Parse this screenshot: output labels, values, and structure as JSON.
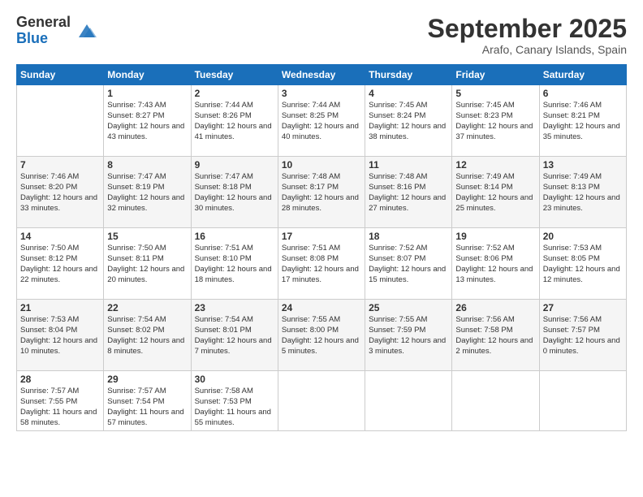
{
  "logo": {
    "general": "General",
    "blue": "Blue"
  },
  "header": {
    "title": "September 2025",
    "subtitle": "Arafo, Canary Islands, Spain"
  },
  "weekdays": [
    "Sunday",
    "Monday",
    "Tuesday",
    "Wednesday",
    "Thursday",
    "Friday",
    "Saturday"
  ],
  "weeks": [
    [
      {
        "num": "",
        "sunrise": "",
        "sunset": "",
        "daylight": ""
      },
      {
        "num": "1",
        "sunrise": "Sunrise: 7:43 AM",
        "sunset": "Sunset: 8:27 PM",
        "daylight": "Daylight: 12 hours and 43 minutes."
      },
      {
        "num": "2",
        "sunrise": "Sunrise: 7:44 AM",
        "sunset": "Sunset: 8:26 PM",
        "daylight": "Daylight: 12 hours and 41 minutes."
      },
      {
        "num": "3",
        "sunrise": "Sunrise: 7:44 AM",
        "sunset": "Sunset: 8:25 PM",
        "daylight": "Daylight: 12 hours and 40 minutes."
      },
      {
        "num": "4",
        "sunrise": "Sunrise: 7:45 AM",
        "sunset": "Sunset: 8:24 PM",
        "daylight": "Daylight: 12 hours and 38 minutes."
      },
      {
        "num": "5",
        "sunrise": "Sunrise: 7:45 AM",
        "sunset": "Sunset: 8:23 PM",
        "daylight": "Daylight: 12 hours and 37 minutes."
      },
      {
        "num": "6",
        "sunrise": "Sunrise: 7:46 AM",
        "sunset": "Sunset: 8:21 PM",
        "daylight": "Daylight: 12 hours and 35 minutes."
      }
    ],
    [
      {
        "num": "7",
        "sunrise": "Sunrise: 7:46 AM",
        "sunset": "Sunset: 8:20 PM",
        "daylight": "Daylight: 12 hours and 33 minutes."
      },
      {
        "num": "8",
        "sunrise": "Sunrise: 7:47 AM",
        "sunset": "Sunset: 8:19 PM",
        "daylight": "Daylight: 12 hours and 32 minutes."
      },
      {
        "num": "9",
        "sunrise": "Sunrise: 7:47 AM",
        "sunset": "Sunset: 8:18 PM",
        "daylight": "Daylight: 12 hours and 30 minutes."
      },
      {
        "num": "10",
        "sunrise": "Sunrise: 7:48 AM",
        "sunset": "Sunset: 8:17 PM",
        "daylight": "Daylight: 12 hours and 28 minutes."
      },
      {
        "num": "11",
        "sunrise": "Sunrise: 7:48 AM",
        "sunset": "Sunset: 8:16 PM",
        "daylight": "Daylight: 12 hours and 27 minutes."
      },
      {
        "num": "12",
        "sunrise": "Sunrise: 7:49 AM",
        "sunset": "Sunset: 8:14 PM",
        "daylight": "Daylight: 12 hours and 25 minutes."
      },
      {
        "num": "13",
        "sunrise": "Sunrise: 7:49 AM",
        "sunset": "Sunset: 8:13 PM",
        "daylight": "Daylight: 12 hours and 23 minutes."
      }
    ],
    [
      {
        "num": "14",
        "sunrise": "Sunrise: 7:50 AM",
        "sunset": "Sunset: 8:12 PM",
        "daylight": "Daylight: 12 hours and 22 minutes."
      },
      {
        "num": "15",
        "sunrise": "Sunrise: 7:50 AM",
        "sunset": "Sunset: 8:11 PM",
        "daylight": "Daylight: 12 hours and 20 minutes."
      },
      {
        "num": "16",
        "sunrise": "Sunrise: 7:51 AM",
        "sunset": "Sunset: 8:10 PM",
        "daylight": "Daylight: 12 hours and 18 minutes."
      },
      {
        "num": "17",
        "sunrise": "Sunrise: 7:51 AM",
        "sunset": "Sunset: 8:08 PM",
        "daylight": "Daylight: 12 hours and 17 minutes."
      },
      {
        "num": "18",
        "sunrise": "Sunrise: 7:52 AM",
        "sunset": "Sunset: 8:07 PM",
        "daylight": "Daylight: 12 hours and 15 minutes."
      },
      {
        "num": "19",
        "sunrise": "Sunrise: 7:52 AM",
        "sunset": "Sunset: 8:06 PM",
        "daylight": "Daylight: 12 hours and 13 minutes."
      },
      {
        "num": "20",
        "sunrise": "Sunrise: 7:53 AM",
        "sunset": "Sunset: 8:05 PM",
        "daylight": "Daylight: 12 hours and 12 minutes."
      }
    ],
    [
      {
        "num": "21",
        "sunrise": "Sunrise: 7:53 AM",
        "sunset": "Sunset: 8:04 PM",
        "daylight": "Daylight: 12 hours and 10 minutes."
      },
      {
        "num": "22",
        "sunrise": "Sunrise: 7:54 AM",
        "sunset": "Sunset: 8:02 PM",
        "daylight": "Daylight: 12 hours and 8 minutes."
      },
      {
        "num": "23",
        "sunrise": "Sunrise: 7:54 AM",
        "sunset": "Sunset: 8:01 PM",
        "daylight": "Daylight: 12 hours and 7 minutes."
      },
      {
        "num": "24",
        "sunrise": "Sunrise: 7:55 AM",
        "sunset": "Sunset: 8:00 PM",
        "daylight": "Daylight: 12 hours and 5 minutes."
      },
      {
        "num": "25",
        "sunrise": "Sunrise: 7:55 AM",
        "sunset": "Sunset: 7:59 PM",
        "daylight": "Daylight: 12 hours and 3 minutes."
      },
      {
        "num": "26",
        "sunrise": "Sunrise: 7:56 AM",
        "sunset": "Sunset: 7:58 PM",
        "daylight": "Daylight: 12 hours and 2 minutes."
      },
      {
        "num": "27",
        "sunrise": "Sunrise: 7:56 AM",
        "sunset": "Sunset: 7:57 PM",
        "daylight": "Daylight: 12 hours and 0 minutes."
      }
    ],
    [
      {
        "num": "28",
        "sunrise": "Sunrise: 7:57 AM",
        "sunset": "Sunset: 7:55 PM",
        "daylight": "Daylight: 11 hours and 58 minutes."
      },
      {
        "num": "29",
        "sunrise": "Sunrise: 7:57 AM",
        "sunset": "Sunset: 7:54 PM",
        "daylight": "Daylight: 11 hours and 57 minutes."
      },
      {
        "num": "30",
        "sunrise": "Sunrise: 7:58 AM",
        "sunset": "Sunset: 7:53 PM",
        "daylight": "Daylight: 11 hours and 55 minutes."
      },
      {
        "num": "",
        "sunrise": "",
        "sunset": "",
        "daylight": ""
      },
      {
        "num": "",
        "sunrise": "",
        "sunset": "",
        "daylight": ""
      },
      {
        "num": "",
        "sunrise": "",
        "sunset": "",
        "daylight": ""
      },
      {
        "num": "",
        "sunrise": "",
        "sunset": "",
        "daylight": ""
      }
    ]
  ]
}
